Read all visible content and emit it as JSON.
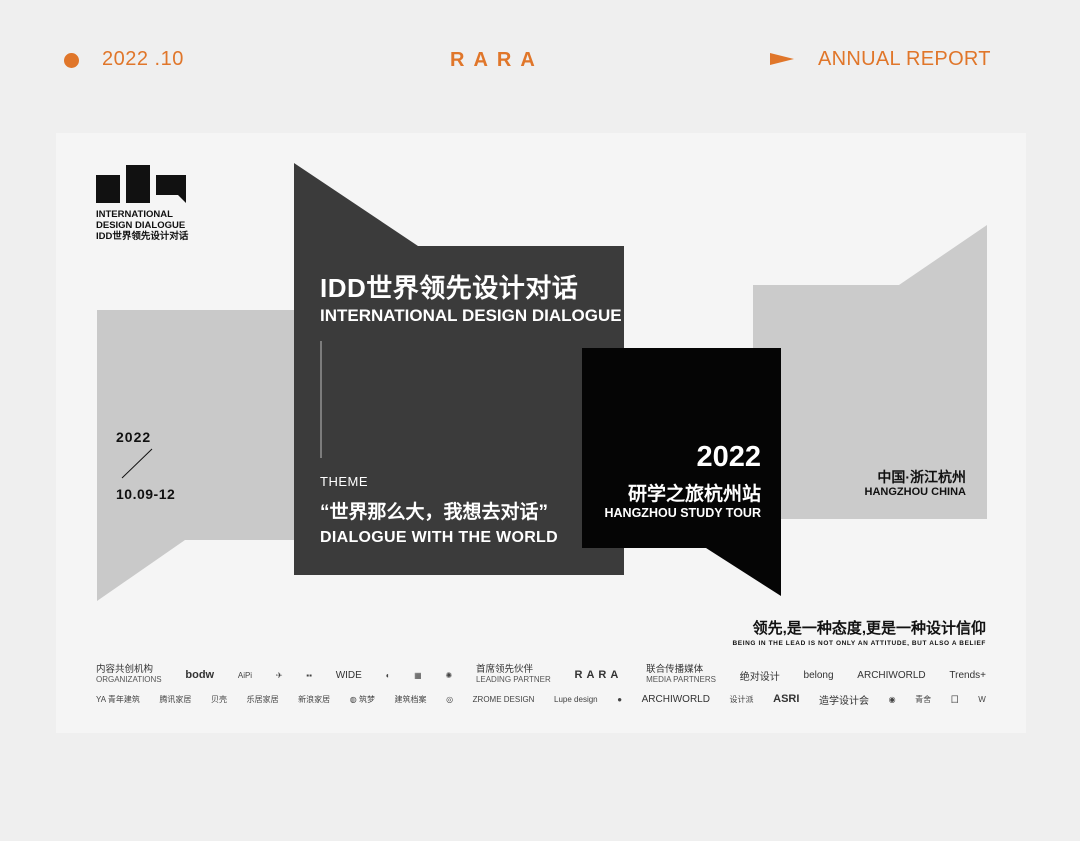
{
  "header": {
    "date": "2022 .10",
    "brand": "RARA",
    "report": "ANNUAL REPORT",
    "accent_color": "#e0762a"
  },
  "poster": {
    "logo_lines": [
      "INTERNATIONAL",
      "DESIGN DIALOGUE",
      "IDD世界领先设计对话"
    ],
    "dates": {
      "year": "2022",
      "range": "10.09-12"
    },
    "title_cn": "IDD世界领先设计对话",
    "title_en": "INTERNATIONAL DESIGN DIALOGUE",
    "theme": {
      "label": "THEME",
      "cn": "“世界那么大，我想去对话”",
      "en": "DIALOGUE WITH THE WORLD"
    },
    "tour": {
      "year": "2022",
      "cn": "研学之旅杭州站",
      "en": "HANGZHOU STUDY TOUR"
    },
    "city": {
      "cn": "中国·浙江杭州",
      "en": "HANGZHOU CHINA"
    },
    "slogan": {
      "cn": "领先,是一种态度,更是一种设计信仰",
      "en": "BEING IN THE LEAD IS NOT ONLY AN ATTITUDE, BUT ALSO A BELIEF"
    }
  },
  "partners": {
    "organizations": {
      "cn": "内容共创机构",
      "en": "ORGANIZATIONS"
    },
    "leading": {
      "cn": "首席领先伙伴",
      "en": "LEADING PARTNER"
    },
    "media": {
      "cn": "联合传播媒体",
      "en": "MEDIA PARTNERS"
    },
    "row1_org_logos": [
      "bodw",
      "AiPi",
      "✈",
      "▪▪",
      "WIDE",
      "◐",
      "▦",
      "✺"
    ],
    "row1_leading_logo": "RARA",
    "row1_media_logos": [
      "绝对设计",
      "belong",
      "ARCHIWORLD",
      "Trends+"
    ],
    "row2_logos": [
      "YA 青年建筑",
      "腾讯家居",
      "贝壳",
      "乐居家居",
      "新浪家居",
      "◍ 筑梦",
      "建筑档案",
      "◎",
      "ZROME DESIGN",
      "Lupe design",
      "●",
      "ARCHIWORLD",
      "设计派",
      "ASRI",
      "造学设计会",
      "◉",
      "青舍",
      "囗",
      "W"
    ]
  }
}
